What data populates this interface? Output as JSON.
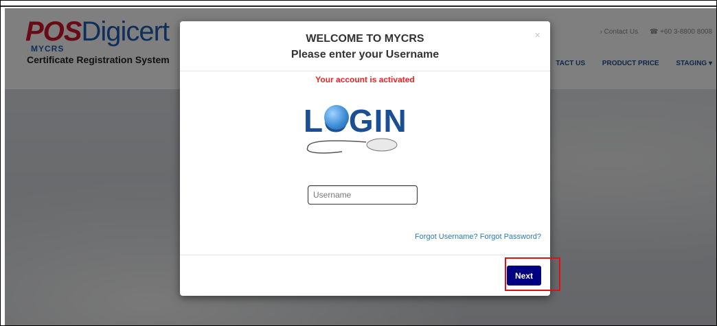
{
  "background": {
    "logo": {
      "part1": "POS",
      "part2": "Digicert",
      "sub": "MYCRS",
      "tagline": "Certificate Registration System"
    },
    "contact": {
      "link": "› Contact Us",
      "phone": "☎ +60 3-8800 8008"
    },
    "nav": [
      "TACT US",
      "PRODUCT PRICE",
      "STAGING ▾"
    ]
  },
  "modal": {
    "title": "WELCOME TO MYCRS",
    "subtitle": "Please enter your Username",
    "close": "×",
    "status": "Your account is activated",
    "image_text": "LOGIN",
    "username": {
      "value": "",
      "placeholder": "Username"
    },
    "forgot_username": "Forgot Username?",
    "forgot_password": "Forgot Password?",
    "next_label": "Next"
  },
  "colors": {
    "status": "#e8251e",
    "button": "#000080",
    "link": "#2a7ab5",
    "highlight": "#e01010"
  }
}
